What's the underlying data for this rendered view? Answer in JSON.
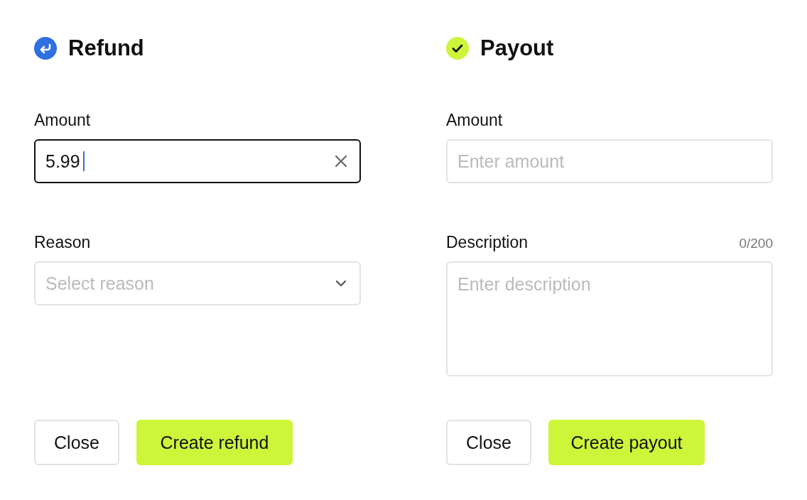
{
  "panels": [
    {
      "kind": "refund",
      "title": "Refund",
      "fields": [
        {
          "kind": "text",
          "label": "Amount",
          "value": "5.99",
          "focused": true
        },
        {
          "kind": "select",
          "label": "Reason",
          "placeholder": "Select reason",
          "focused": false
        }
      ],
      "buttons": [
        {
          "kind": "secondary",
          "label": "Close"
        },
        {
          "kind": "primary",
          "label": "Create refund"
        }
      ]
    },
    {
      "kind": "payout",
      "title": "Payout",
      "fields": [
        {
          "kind": "text",
          "label": "Amount",
          "placeholder": "Enter amount",
          "focused": false
        },
        {
          "kind": "textarea",
          "label": "Description",
          "counter": "0/200",
          "placeholder": "Enter description",
          "focused": false
        }
      ],
      "buttons": [
        {
          "kind": "secondary",
          "label": "Close"
        },
        {
          "kind": "primary",
          "label": "Create payout"
        }
      ]
    }
  ]
}
